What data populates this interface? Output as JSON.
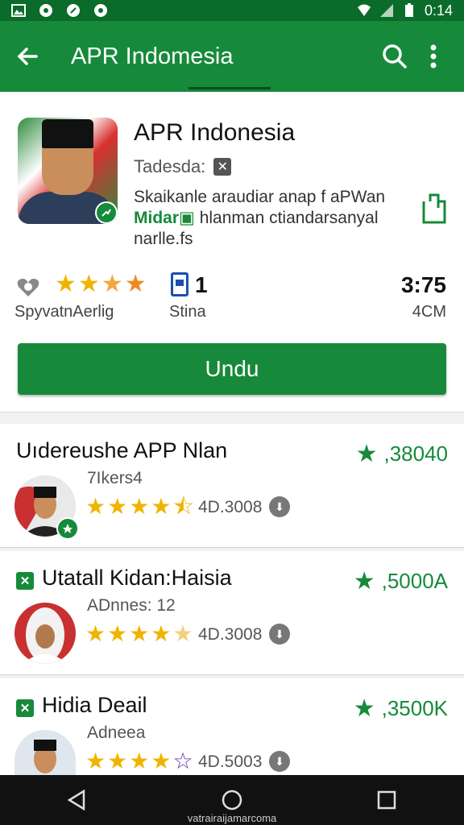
{
  "status_bar": {
    "time": "0:14"
  },
  "app_bar": {
    "title": "APR Indomesia"
  },
  "app": {
    "name": "APR Indonesia",
    "developer": "Tadesda:",
    "description_line1": "Skaikanle araudiar anap f aPWan",
    "description_green": "Midar",
    "description_line2": "hlanman ctiandarsanyal",
    "description_line3": "narlle.fs",
    "rating_label": "SpyvatnAerlig",
    "rating_stars": 4.5,
    "downloads_value": "1",
    "downloads_label": "Stina",
    "size_value": "3:75",
    "size_label": "4CM",
    "install_label": "Undu"
  },
  "related": [
    {
      "title": "Uıdereushe APP Nlan",
      "subtitle": "7Ikers4",
      "rating": ",38040",
      "stars": 4.5,
      "size": "4D.3008"
    },
    {
      "title": "Utatall Kidan:Haisia",
      "subtitle": "ADnnes: 12",
      "rating": ",5000A",
      "stars": 4.5,
      "size": "4D.3008"
    },
    {
      "title": "Hidia Deail",
      "subtitle": "Adneea",
      "rating": ",3500K",
      "stars": 4,
      "size": "4D.5003"
    }
  ],
  "nav_bar": {
    "caption": "vatrairaijamarcoma"
  },
  "colors": {
    "brand_green": "#168a3a",
    "status_green": "#0b6b2a",
    "star_gold": "#f0b400"
  }
}
